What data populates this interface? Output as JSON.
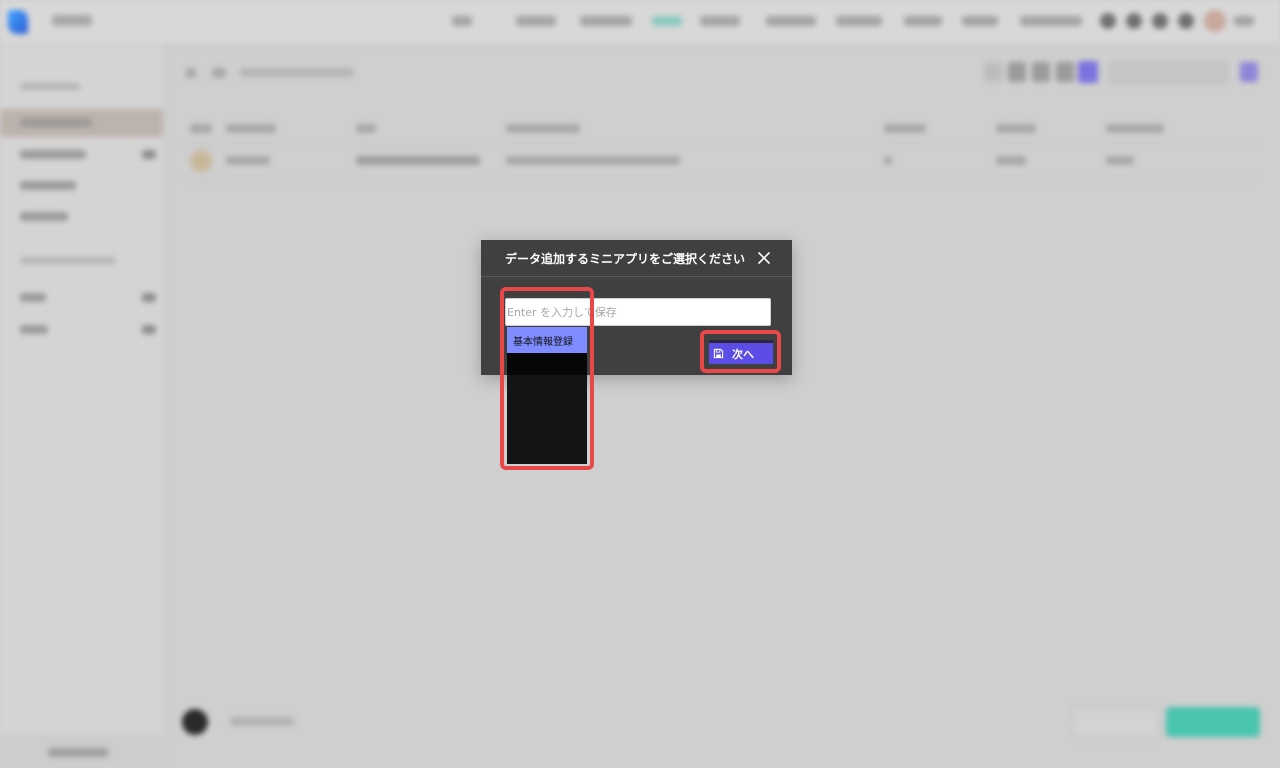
{
  "modal": {
    "title": "データ追加するミニアプリをご選択ください",
    "input_placeholder": "Enter を入力して保存",
    "next_button_label": "次へ"
  },
  "dropdown": {
    "items": [
      {
        "label": "基本情報登録"
      }
    ]
  },
  "icons": {
    "close": "close-icon",
    "save": "save-icon"
  },
  "colors": {
    "accent": "#5b4de6",
    "dropdown_highlight": "#7e8cff",
    "annotation": "#e84848",
    "modal_bg": "#404040"
  }
}
